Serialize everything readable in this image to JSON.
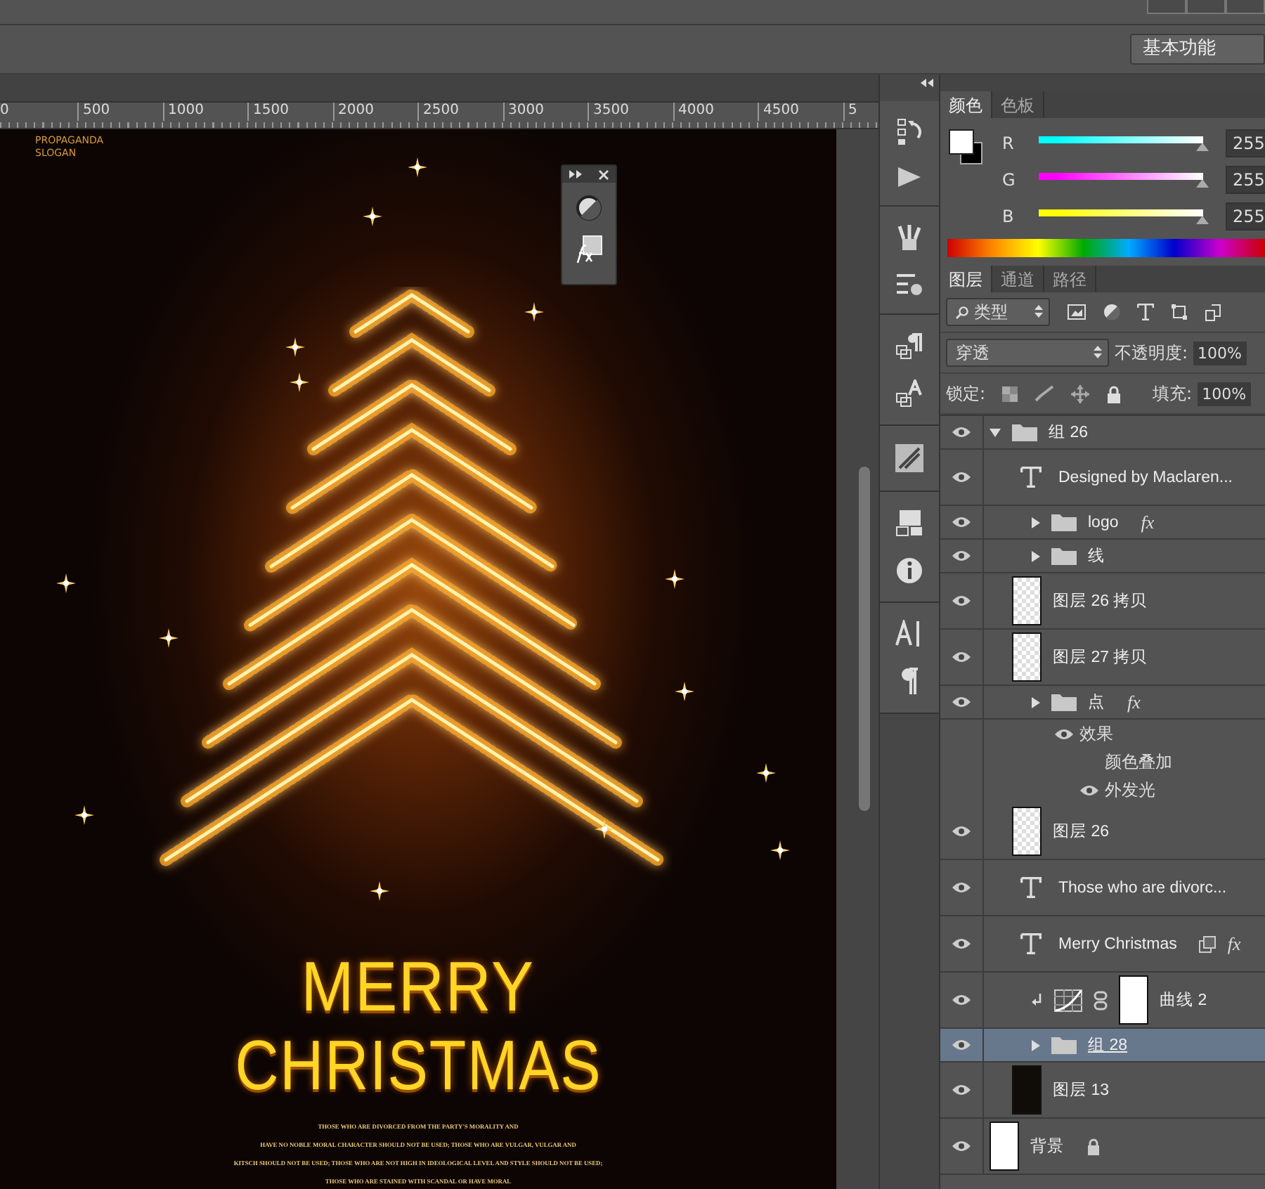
{
  "workspace": {
    "label": "基本功能"
  },
  "ruler": {
    "ticks": [
      "0",
      "500",
      "1000",
      "1500",
      "2000",
      "2500",
      "3000",
      "3500",
      "4000",
      "4500",
      "5"
    ]
  },
  "poster": {
    "slogan": [
      "PROPAGANDA",
      "SLOGAN"
    ],
    "title": [
      "MERRY",
      "CHRISTMAS"
    ],
    "body": [
      "THOSE WHO ARE DIVORCED FROM THE PARTY'S MORALITY AND",
      "HAVE NO NOBLE MORAL CHARACTER SHOULD NOT BE USED; THOSE WHO ARE VULGAR, VULGAR AND",
      "KITSCH SHOULD NOT BE USED; THOSE WHO ARE NOT HIGH IN IDEOLOGICAL LEVEL AND STYLE SHOULD NOT BE USED;",
      "THOSE WHO ARE STAINED WITH SCANDAL OR HAVE MORAL"
    ]
  },
  "color_panel": {
    "tabs": [
      {
        "label": "颜色",
        "selected": true
      },
      {
        "label": "色板",
        "selected": false
      }
    ],
    "channels": [
      {
        "name": "R",
        "value": "255",
        "level": 1,
        "color": "#00ffff"
      },
      {
        "name": "G",
        "value": "255",
        "level": 1,
        "color": "#ff00ff"
      },
      {
        "name": "B",
        "value": "255",
        "level": 1,
        "color": "#ffff00"
      }
    ]
  },
  "layers_panel": {
    "tabs": [
      {
        "label": "图层",
        "selected": true
      },
      {
        "label": "通道",
        "selected": false
      },
      {
        "label": "路径",
        "selected": false
      }
    ],
    "filter": "类型",
    "blend_mode": "穿透",
    "opacity_label": "不透明度:",
    "opacity": "100%",
    "lock_label": "锁定:",
    "fill_label": "填充:",
    "fill": "100%",
    "layers": [
      {
        "name": "组 26",
        "kind": "group",
        "visible": true,
        "selected": false,
        "expanded": true,
        "children": [
          {
            "name": "Designed by Maclaren...",
            "kind": "text",
            "visible": true,
            "selected": false
          },
          {
            "name": "logo",
            "kind": "group",
            "visible": true,
            "selected": false,
            "expanded": false,
            "fx": "fx"
          },
          {
            "name": "线",
            "kind": "group",
            "visible": true,
            "selected": false,
            "expanded": false
          },
          {
            "name": "图层 26 拷贝",
            "kind": "pixel",
            "visible": true,
            "selected": false
          },
          {
            "name": "图层 27 拷贝",
            "kind": "pixel",
            "visible": true,
            "selected": false
          },
          {
            "name": "点",
            "kind": "group",
            "visible": true,
            "selected": false,
            "expanded": false,
            "fx": "fx",
            "effects": {
              "label": "效果",
              "visible": true,
              "items": [
                {
                  "label": "颜色叠加",
                  "visible": false
                },
                {
                  "label": "外发光",
                  "visible": true
                }
              ]
            }
          },
          {
            "name": "图层 26",
            "kind": "pixel",
            "visible": true,
            "selected": false
          },
          {
            "name": "Those who are divorc...",
            "kind": "text",
            "visible": true,
            "selected": false
          },
          {
            "name": "Merry Christmas",
            "kind": "text",
            "visible": true,
            "selected": false,
            "fx": "fx",
            "smart": true
          },
          {
            "name": "曲线 2",
            "kind": "adjustment",
            "visible": true,
            "selected": false,
            "clipped": true
          },
          {
            "name": "组 28",
            "kind": "group",
            "visible": true,
            "selected": true,
            "expanded": false
          },
          {
            "name": "图层 13",
            "kind": "dark",
            "visible": true,
            "selected": false
          }
        ]
      },
      {
        "name": "背景",
        "kind": "background",
        "visible": true,
        "selected": false,
        "locked": true
      }
    ]
  }
}
